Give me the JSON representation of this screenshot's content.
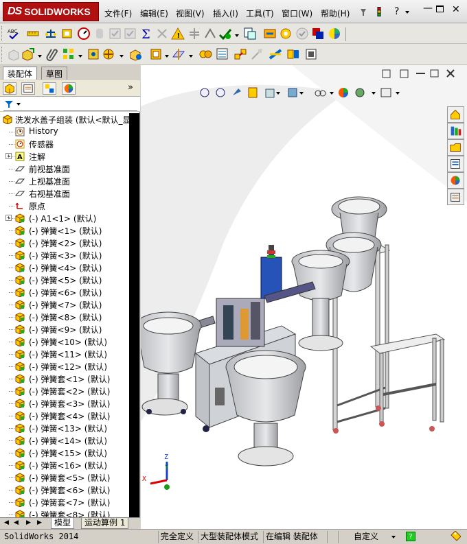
{
  "app": {
    "logo_text": "SOLIDWORKS",
    "logo_mark": "DS"
  },
  "menu": [
    {
      "label": "文件(F)"
    },
    {
      "label": "编辑(E)"
    },
    {
      "label": "视图(V)"
    },
    {
      "label": "插入(I)"
    },
    {
      "label": "工具(T)"
    },
    {
      "label": "窗口(W)"
    },
    {
      "label": "帮助(H)"
    }
  ],
  "panel_tabs": {
    "assembly": "装配体",
    "sketch": "草图"
  },
  "feature_tree": {
    "root": "洗发水盖子组装 (默认<默认_显示",
    "items": [
      {
        "label": "History",
        "icon": "history-icon"
      },
      {
        "label": "传感器",
        "icon": "sensor-icon"
      },
      {
        "label": "注解",
        "icon": "annotation-icon",
        "expandable": true
      },
      {
        "label": "前视基准面",
        "icon": "plane-icon"
      },
      {
        "label": "上视基准面",
        "icon": "plane-icon"
      },
      {
        "label": "右视基准面",
        "icon": "plane-icon"
      },
      {
        "label": "原点",
        "icon": "origin-icon"
      },
      {
        "label": "(-) A1<1> (默认)",
        "icon": "part-icon",
        "expandable": true
      },
      {
        "label": "(-) 弹簧<1> (默认)",
        "icon": "part-icon"
      },
      {
        "label": "(-) 弹簧<2> (默认)",
        "icon": "part-icon"
      },
      {
        "label": "(-) 弹簧<3> (默认)",
        "icon": "part-icon"
      },
      {
        "label": "(-) 弹簧<4> (默认)",
        "icon": "part-icon"
      },
      {
        "label": "(-) 弹簧<5> (默认)",
        "icon": "part-icon"
      },
      {
        "label": "(-) 弹簧<6> (默认)",
        "icon": "part-icon"
      },
      {
        "label": "(-) 弹簧<7> (默认)",
        "icon": "part-icon"
      },
      {
        "label": "(-) 弹簧<8> (默认)",
        "icon": "part-icon"
      },
      {
        "label": "(-) 弹簧<9> (默认)",
        "icon": "part-icon"
      },
      {
        "label": "(-) 弹簧<10> (默认)",
        "icon": "part-icon"
      },
      {
        "label": "(-) 弹簧<11> (默认)",
        "icon": "part-icon"
      },
      {
        "label": "(-) 弹簧<12> (默认)",
        "icon": "part-icon"
      },
      {
        "label": "(-) 弹簧套<1> (默认)",
        "icon": "part-icon"
      },
      {
        "label": "(-) 弹簧套<2> (默认)",
        "icon": "part-icon"
      },
      {
        "label": "(-) 弹簧套<3> (默认)",
        "icon": "part-icon"
      },
      {
        "label": "(-) 弹簧套<4> (默认)",
        "icon": "part-icon"
      },
      {
        "label": "(-) 弹簧<13> (默认)",
        "icon": "part-icon"
      },
      {
        "label": "(-) 弹簧<14> (默认)",
        "icon": "part-icon"
      },
      {
        "label": "(-) 弹簧<15> (默认)",
        "icon": "part-icon"
      },
      {
        "label": "(-) 弹簧<16> (默认)",
        "icon": "part-icon"
      },
      {
        "label": "(-) 弹簧套<5> (默认)",
        "icon": "part-icon"
      },
      {
        "label": "(-) 弹簧套<6> (默认)",
        "icon": "part-icon"
      },
      {
        "label": "(-) 弹簧套<7> (默认)",
        "icon": "part-icon"
      },
      {
        "label": "(-) 弹簧套<8> (默认)",
        "icon": "part-icon"
      }
    ]
  },
  "bottom_tabs": {
    "model": "模型",
    "motion": "运动算例 1"
  },
  "status": {
    "app_version": "SolidWorks 2014",
    "cells": [
      "完全定义",
      "大型装配体模式",
      "在编辑 装配体",
      "自定义"
    ]
  },
  "triad": {
    "x": "X",
    "y": "Y",
    "z": "Z"
  },
  "colors": {
    "logo_red": "#b01010",
    "tree_scrollbar": "#000000",
    "viewport_bg": "#ffffff"
  }
}
